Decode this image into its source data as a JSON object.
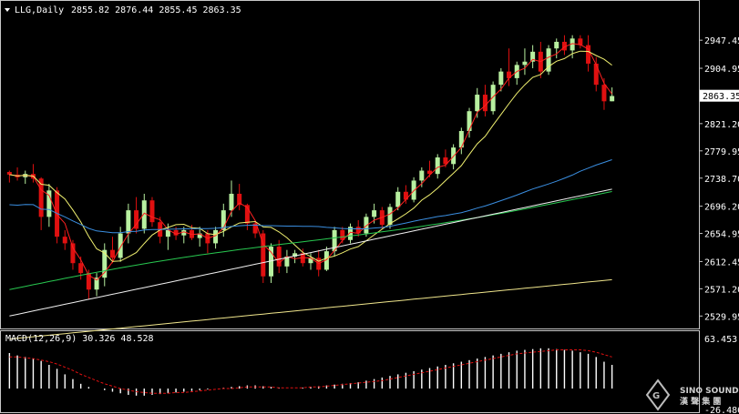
{
  "header": {
    "symbol_text": "LLG,Daily",
    "ohlc_text": "2855.82 2876.44 2855.45 2863.35",
    "macd_text": "MACD(12,26,9) 30.326 48.528"
  },
  "logo": {
    "line1": "SINO SOUND",
    "line2": "漢 聲 集 團"
  },
  "colors": {
    "background": "#000000",
    "frame": "#c8c8c8",
    "bull": "#b8f0a0",
    "bear": "#e01010",
    "ma_fast": "#ff2020",
    "ma_mid": "#f0f070",
    "ma_slow1": "#3a8ee0",
    "ma_slow2": "#28c850",
    "ma_slow3": "#f0f0f0",
    "ma_slow4": "#f0e68c",
    "macd_hist": "#ffffff",
    "macd_signal": "#e01010",
    "price_label_bg": "#ffffff"
  },
  "chart_data": [
    {
      "type": "candlestick",
      "title": "LLG,Daily",
      "y_ticks": [
        "2947.45",
        "2904.95",
        "2863.35",
        "2821.20",
        "2779.95",
        "2738.70",
        "2696.20",
        "2654.95",
        "2612.45",
        "2571.20",
        "2529.95"
      ],
      "ylim": [
        2518,
        2978
      ],
      "current_price": "2863.35",
      "candles": [
        [
          2748,
          2750,
          2732,
          2744
        ],
        [
          2744,
          2755,
          2735,
          2740
        ],
        [
          2740,
          2750,
          2730,
          2745
        ],
        [
          2745,
          2760,
          2732,
          2738
        ],
        [
          2738,
          2740,
          2660,
          2680
        ],
        [
          2680,
          2730,
          2665,
          2720
        ],
        [
          2720,
          2725,
          2640,
          2650
        ],
        [
          2650,
          2660,
          2630,
          2640
        ],
        [
          2640,
          2645,
          2600,
          2610
        ],
        [
          2610,
          2620,
          2585,
          2595
        ],
        [
          2595,
          2600,
          2555,
          2570
        ],
        [
          2570,
          2595,
          2560,
          2588
        ],
        [
          2588,
          2640,
          2575,
          2630
        ],
        [
          2630,
          2650,
          2610,
          2618
        ],
        [
          2618,
          2665,
          2612,
          2655
        ],
        [
          2655,
          2700,
          2640,
          2690
        ],
        [
          2690,
          2710,
          2655,
          2662
        ],
        [
          2662,
          2715,
          2655,
          2705
        ],
        [
          2705,
          2710,
          2665,
          2672
        ],
        [
          2672,
          2680,
          2640,
          2650
        ],
        [
          2650,
          2670,
          2630,
          2660
        ],
        [
          2660,
          2665,
          2645,
          2652
        ],
        [
          2652,
          2665,
          2640,
          2660
        ],
        [
          2660,
          2668,
          2645,
          2648
        ],
        [
          2648,
          2665,
          2635,
          2655
        ],
        [
          2655,
          2660,
          2625,
          2640
        ],
        [
          2640,
          2665,
          2632,
          2660
        ],
        [
          2660,
          2700,
          2650,
          2690
        ],
        [
          2690,
          2735,
          2680,
          2715
        ],
        [
          2715,
          2730,
          2690,
          2698
        ],
        [
          2698,
          2700,
          2660,
          2670
        ],
        [
          2670,
          2675,
          2648,
          2655
        ],
        [
          2655,
          2660,
          2580,
          2590
        ],
        [
          2590,
          2640,
          2580,
          2635
        ],
        [
          2635,
          2645,
          2595,
          2605
        ],
        [
          2605,
          2630,
          2595,
          2620
        ],
        [
          2620,
          2630,
          2610,
          2625
        ],
        [
          2625,
          2632,
          2605,
          2610
        ],
        [
          2610,
          2625,
          2600,
          2618
        ],
        [
          2618,
          2630,
          2590,
          2600
        ],
        [
          2600,
          2635,
          2598,
          2628
        ],
        [
          2628,
          2665,
          2620,
          2660
        ],
        [
          2660,
          2665,
          2640,
          2645
        ],
        [
          2645,
          2670,
          2640,
          2665
        ],
        [
          2665,
          2675,
          2650,
          2655
        ],
        [
          2655,
          2685,
          2650,
          2680
        ],
        [
          2680,
          2700,
          2670,
          2690
        ],
        [
          2690,
          2695,
          2662,
          2668
        ],
        [
          2668,
          2700,
          2662,
          2695
        ],
        [
          2695,
          2725,
          2690,
          2718
        ],
        [
          2718,
          2728,
          2700,
          2706
        ],
        [
          2706,
          2740,
          2702,
          2735
        ],
        [
          2735,
          2755,
          2725,
          2750
        ],
        [
          2750,
          2765,
          2740,
          2745
        ],
        [
          2745,
          2775,
          2738,
          2770
        ],
        [
          2770,
          2782,
          2755,
          2760
        ],
        [
          2760,
          2790,
          2752,
          2785
        ],
        [
          2785,
          2815,
          2775,
          2810
        ],
        [
          2810,
          2845,
          2800,
          2840
        ],
        [
          2840,
          2875,
          2830,
          2865
        ],
        [
          2865,
          2880,
          2832,
          2840
        ],
        [
          2840,
          2885,
          2835,
          2880
        ],
        [
          2880,
          2905,
          2870,
          2900
        ],
        [
          2900,
          2935,
          2878,
          2890
        ],
        [
          2890,
          2915,
          2880,
          2910
        ],
        [
          2910,
          2935,
          2895,
          2915
        ],
        [
          2915,
          2940,
          2905,
          2930
        ],
        [
          2930,
          2945,
          2890,
          2900
        ],
        [
          2900,
          2940,
          2895,
          2935
        ],
        [
          2935,
          2950,
          2920,
          2945
        ],
        [
          2945,
          2955,
          2925,
          2932
        ],
        [
          2932,
          2955,
          2920,
          2950
        ],
        [
          2950,
          2955,
          2935,
          2940
        ],
        [
          2940,
          2955,
          2900,
          2912
        ],
        [
          2912,
          2922,
          2870,
          2880
        ],
        [
          2880,
          2890,
          2842,
          2855
        ],
        [
          2855,
          2876,
          2855,
          2863
        ]
      ],
      "indicator_pane": {
        "title": "MACD(12,26,9) 30.326 48.528",
        "y_ticks": [
          "63.453",
          "-26.486"
        ],
        "ylim": [
          -26.486,
          63.453
        ],
        "histogram": [
          45,
          42,
          40,
          38,
          35,
          30,
          25,
          18,
          12,
          6,
          2,
          0,
          -2,
          -4,
          -6,
          -8,
          -9,
          -9,
          -8,
          -7,
          -6,
          -5,
          -4,
          -3,
          -2,
          -1,
          0,
          1,
          2,
          3,
          4,
          4,
          3,
          2,
          1,
          0,
          0,
          1,
          2,
          3,
          4,
          5,
          6,
          7,
          8,
          10,
          12,
          14,
          16,
          18,
          20,
          22,
          24,
          26,
          28,
          30,
          32,
          34,
          36,
          38,
          40,
          42,
          44,
          46,
          48,
          49,
          50,
          51,
          51,
          50,
          49,
          48,
          46,
          44,
          40,
          34,
          30
        ],
        "signal": [
          40,
          40,
          39,
          38,
          36,
          34,
          31,
          27,
          23,
          18,
          14,
          10,
          6,
          3,
          0,
          -2,
          -4,
          -5,
          -6,
          -6,
          -6,
          -5,
          -5,
          -4,
          -3,
          -2,
          -1,
          0,
          0,
          1,
          2,
          2,
          2,
          2,
          1,
          1,
          1,
          1,
          2,
          2,
          3,
          4,
          5,
          6,
          7,
          8,
          9,
          10,
          12,
          14,
          16,
          18,
          20,
          22,
          24,
          26,
          28,
          30,
          32,
          34,
          36,
          38,
          40,
          42,
          44,
          45,
          46,
          47,
          48,
          49,
          49,
          49,
          49,
          48,
          46,
          43,
          40
        ]
      }
    }
  ]
}
